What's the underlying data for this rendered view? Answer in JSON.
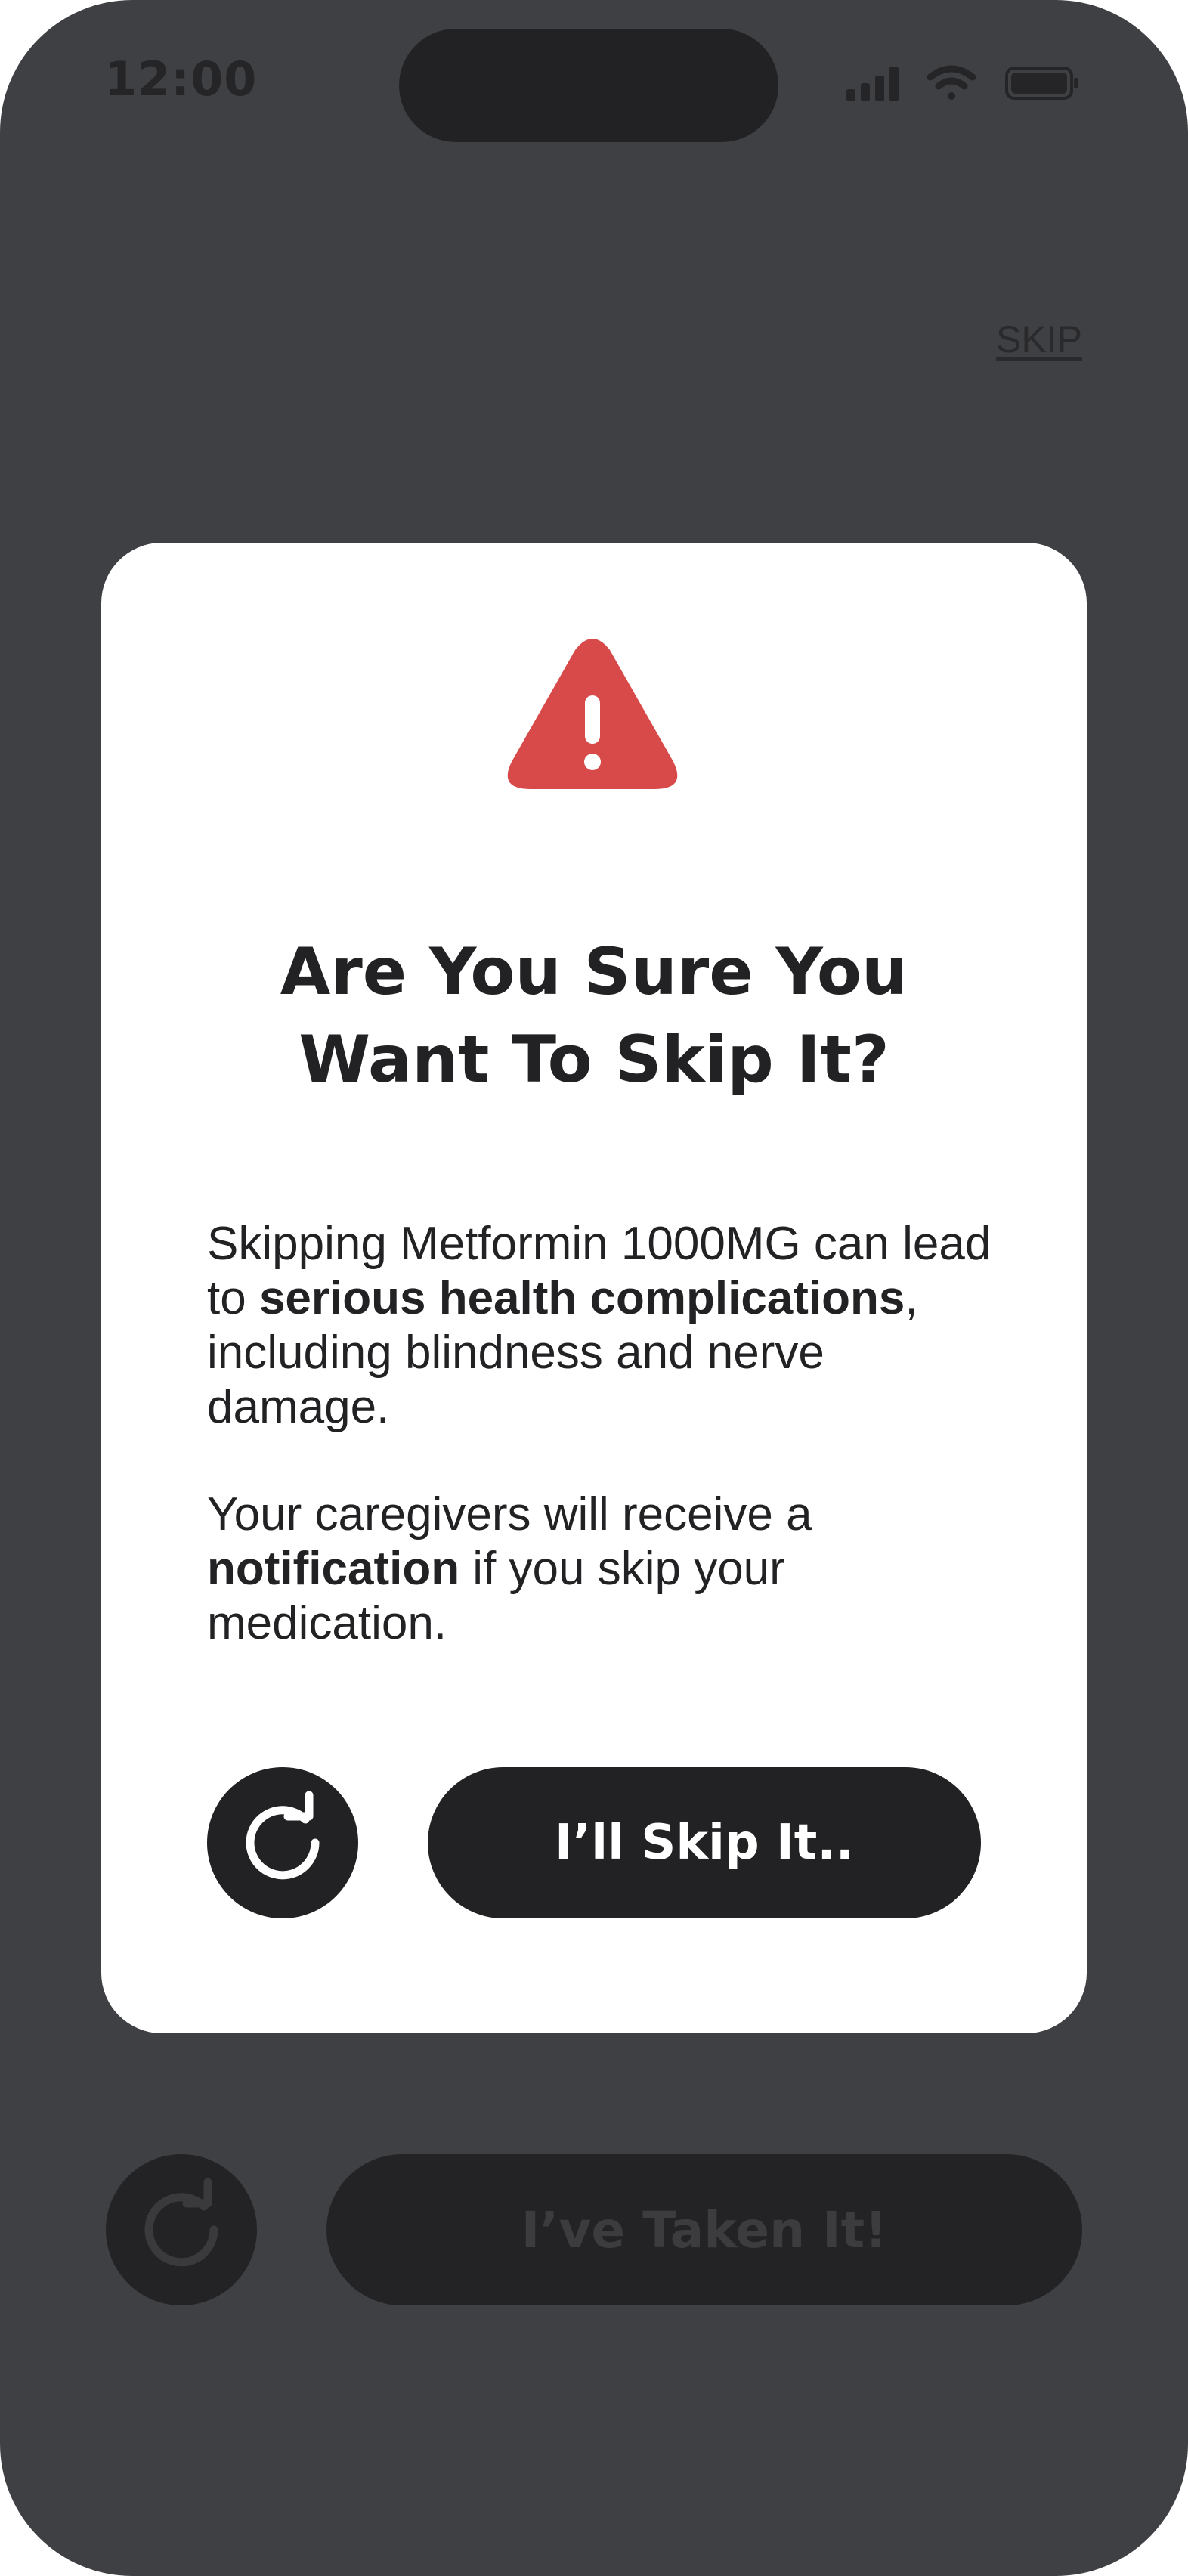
{
  "status_bar": {
    "time": "12:00",
    "icons": [
      "cellular-signal-icon",
      "wifi-icon",
      "battery-icon"
    ]
  },
  "header": {
    "skip_label": "SKIP"
  },
  "background_actions": {
    "repeat_icon": "repeat-icon",
    "taken_label": "I’ve Taken It!"
  },
  "dialog": {
    "icon": "warning-icon",
    "title_line1": "Are You Sure You",
    "title_line2": "Want To Skip It?",
    "paragraph1": {
      "before": "Skipping Metformin 1000MG can lead to ",
      "bold": "serious health complications",
      "after": ", including blindness and nerve damage."
    },
    "paragraph2": {
      "before": "Your caregivers will receive a ",
      "bold": "notification",
      "after": " if you skip your medication."
    },
    "repeat_icon": "repeat-icon",
    "confirm_label": "I’ll Skip It.."
  },
  "colors": {
    "backdrop": "#3f4043",
    "dark": "#222224",
    "warning": "#d84a4a",
    "modal_bg": "#ffffff"
  }
}
